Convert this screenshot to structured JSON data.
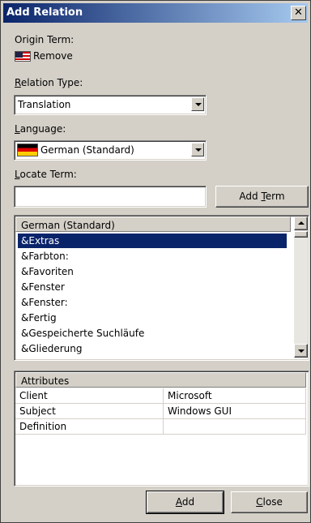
{
  "window": {
    "title": "Add Relation",
    "close_glyph": "✕"
  },
  "origin": {
    "label": "Origin Term:",
    "term": "Remove",
    "flag_icon": "us-flag-icon"
  },
  "relation_type": {
    "label_underlined": "R",
    "label_rest": "elation Type:",
    "value": "Translation"
  },
  "language": {
    "label_underlined": "L",
    "label_rest": "anguage:",
    "value": "German (Standard)",
    "flag_icon": "german-flag-icon"
  },
  "locate": {
    "label_underlined": "L",
    "label_rest": "ocate Term:",
    "value": ""
  },
  "add_term_button": {
    "label_before": "Add ",
    "label_underlined": "T",
    "label_after": "erm"
  },
  "term_list": {
    "header": "German (Standard)",
    "items": [
      "&Extras",
      "&Farbton:",
      "&Favoriten",
      "&Fenster",
      "&Fenster:",
      "&Fertig",
      "&Gespeicherte Suchläufe",
      "&Gliederung"
    ],
    "selected_index": 0
  },
  "attributes": {
    "header": "Attributes",
    "rows": [
      {
        "name": "Client",
        "value": "Microsoft"
      },
      {
        "name": "Subject",
        "value": "Windows GUI"
      },
      {
        "name": "Definition",
        "value": ""
      }
    ]
  },
  "buttons": {
    "add": {
      "label_underlined": "A",
      "label_rest": "dd"
    },
    "close": {
      "label_underlined": "C",
      "label_rest": "lose"
    }
  }
}
